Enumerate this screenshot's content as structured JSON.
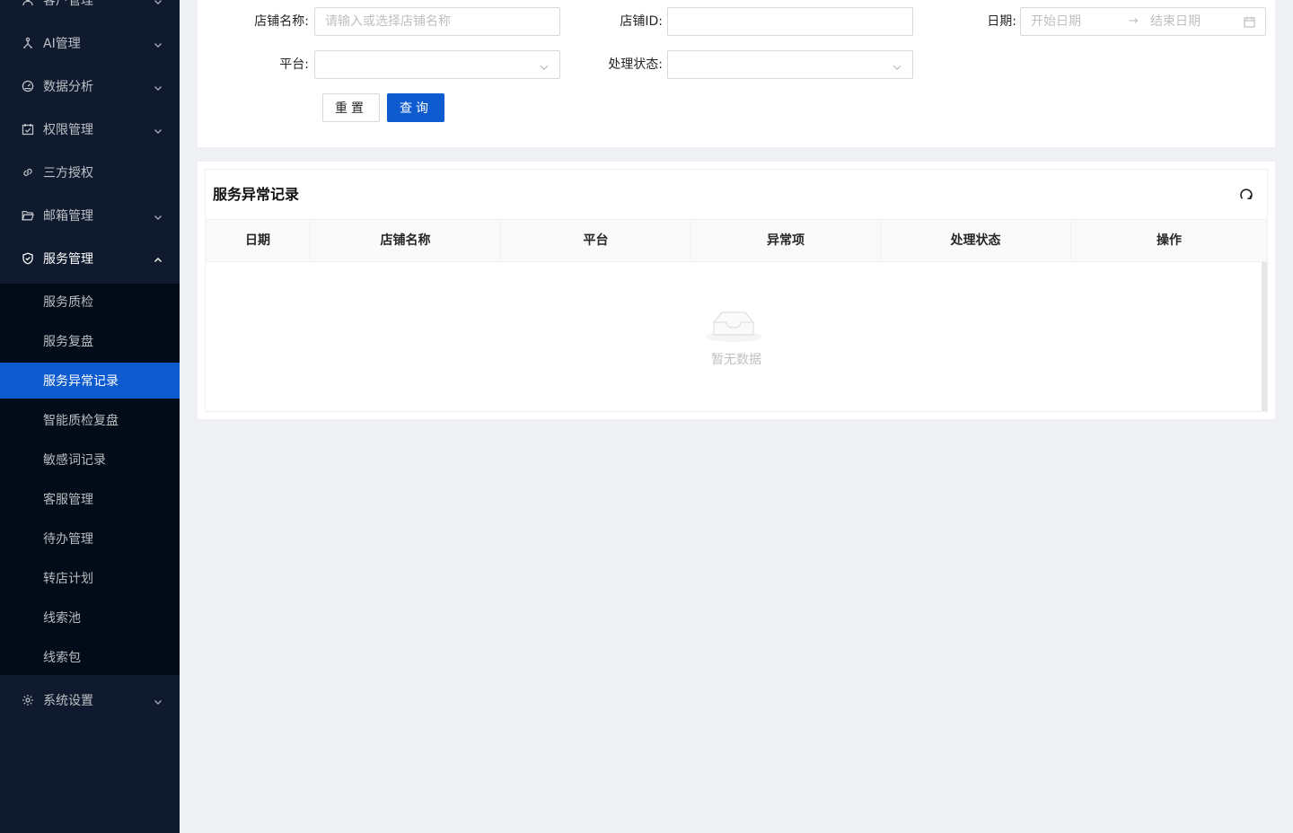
{
  "sidebar": {
    "items": [
      {
        "label": "客户管理",
        "icon": "customer-icon"
      },
      {
        "label": "AI管理",
        "icon": "ai-icon"
      },
      {
        "label": "数据分析",
        "icon": "dashboard-icon"
      },
      {
        "label": "权限管理",
        "icon": "calendar-check-icon"
      },
      {
        "label": "三方授权",
        "icon": "link-icon"
      },
      {
        "label": "邮箱管理",
        "icon": "folder-icon"
      },
      {
        "label": "服务管理",
        "icon": "shield-check-icon"
      },
      {
        "label": "系统设置",
        "icon": "gear-icon"
      }
    ],
    "submenu": [
      {
        "label": "服务质检"
      },
      {
        "label": "服务复盘"
      },
      {
        "label": "服务异常记录"
      },
      {
        "label": "智能质检复盘"
      },
      {
        "label": "敏感词记录"
      },
      {
        "label": "客服管理"
      },
      {
        "label": "待办管理"
      },
      {
        "label": "转店计划"
      },
      {
        "label": "线索池"
      },
      {
        "label": "线索包"
      }
    ],
    "active_sub": "服务异常记录"
  },
  "filters": {
    "shop_name_label": "店铺名称:",
    "shop_name_placeholder": "请输入或选择店铺名称",
    "shop_id_label": "店铺ID:",
    "date_label": "日期:",
    "date_start_placeholder": "开始日期",
    "date_arrow": "→",
    "date_end_placeholder": "结束日期",
    "platform_label": "平台:",
    "status_label": "处理状态:",
    "reset_button": "重置",
    "query_button": "查询"
  },
  "table": {
    "title": "服务异常记录",
    "columns": [
      "日期",
      "店铺名称",
      "平台",
      "异常项",
      "处理状态",
      "操作"
    ],
    "rows": [],
    "empty_text": "暂无数据"
  },
  "colors": {
    "sidebar_bg": "#0f1a2e",
    "submenu_bg": "#020b18",
    "accent": "#0e5bd0",
    "page_bg": "#eef0f4"
  }
}
